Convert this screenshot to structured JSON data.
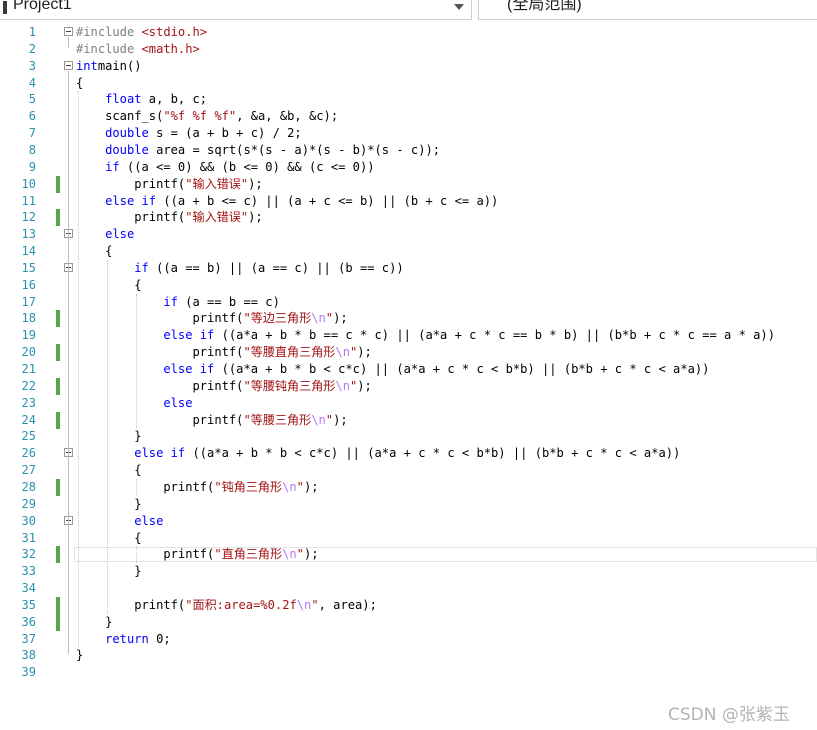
{
  "toolbar": {
    "project_combo": "Project1",
    "scope_combo": "(全局范围)"
  },
  "watermark": "CSDN @张紫玉",
  "code_lines": [
    [
      [
        "pp",
        "#include "
      ],
      [
        "str",
        "<stdio.h>"
      ]
    ],
    [
      [
        "pp",
        "#include "
      ],
      [
        "str",
        "<math.h>"
      ]
    ],
    [
      [
        "kw",
        "int"
      ],
      [
        "",
        "main()"
      ]
    ],
    [
      [
        "",
        "{"
      ]
    ],
    [
      [
        "",
        "    "
      ],
      [
        "kw",
        "float"
      ],
      [
        "",
        " a, b, c;"
      ]
    ],
    [
      [
        "",
        "    scanf_s("
      ],
      [
        "str",
        "\"%f %f %f\""
      ],
      [
        "",
        ", &a, &b, &c);"
      ]
    ],
    [
      [
        "",
        "    "
      ],
      [
        "kw",
        "double"
      ],
      [
        "",
        " s = (a + b + c) / 2;"
      ]
    ],
    [
      [
        "",
        "    "
      ],
      [
        "kw",
        "double"
      ],
      [
        "",
        " area = sqrt(s*(s - a)*(s - b)*(s - c));"
      ]
    ],
    [
      [
        "",
        "    "
      ],
      [
        "kw",
        "if"
      ],
      [
        "",
        " ((a <= 0) && (b <= 0) && (c <= 0))"
      ]
    ],
    [
      [
        "",
        "        printf("
      ],
      [
        "str",
        "\"输入错误\""
      ],
      [
        "",
        ");"
      ]
    ],
    [
      [
        "",
        "    "
      ],
      [
        "kw",
        "else if"
      ],
      [
        "",
        " ((a + b <= c) || (a + c <= b) || (b + c <= a))"
      ]
    ],
    [
      [
        "",
        "        printf("
      ],
      [
        "str",
        "\"输入错误\""
      ],
      [
        "",
        ");"
      ]
    ],
    [
      [
        "",
        "    "
      ],
      [
        "kw",
        "else"
      ]
    ],
    [
      [
        "",
        "    {"
      ]
    ],
    [
      [
        "",
        "        "
      ],
      [
        "kw",
        "if"
      ],
      [
        "",
        " ((a == b) || (a == c) || (b == c))"
      ]
    ],
    [
      [
        "",
        "        {"
      ]
    ],
    [
      [
        "",
        "            "
      ],
      [
        "kw",
        "if"
      ],
      [
        "",
        " (a == b == c)"
      ]
    ],
    [
      [
        "",
        "                printf("
      ],
      [
        "str",
        "\"等边三角形"
      ],
      [
        "esc",
        "\\n"
      ],
      [
        "str",
        "\""
      ],
      [
        "",
        ");"
      ]
    ],
    [
      [
        "",
        "            "
      ],
      [
        "kw",
        "else if"
      ],
      [
        "",
        " ((a*a + b * b == c * c) || (a*a + c * c == b * b) || (b*b + c * c == a * a))"
      ]
    ],
    [
      [
        "",
        "                printf("
      ],
      [
        "str",
        "\"等腰直角三角形"
      ],
      [
        "esc",
        "\\n"
      ],
      [
        "str",
        "\""
      ],
      [
        "",
        ");"
      ]
    ],
    [
      [
        "",
        "            "
      ],
      [
        "kw",
        "else if"
      ],
      [
        "",
        " ((a*a + b * b < c*c) || (a*a + c * c < b*b) || (b*b + c * c < a*a))"
      ]
    ],
    [
      [
        "",
        "                printf("
      ],
      [
        "str",
        "\"等腰钝角三角形"
      ],
      [
        "esc",
        "\\n"
      ],
      [
        "str",
        "\""
      ],
      [
        "",
        ");"
      ]
    ],
    [
      [
        "",
        "            "
      ],
      [
        "kw",
        "else"
      ]
    ],
    [
      [
        "",
        "                printf("
      ],
      [
        "str",
        "\"等腰三角形"
      ],
      [
        "esc",
        "\\n"
      ],
      [
        "str",
        "\""
      ],
      [
        "",
        ");"
      ]
    ],
    [
      [
        "",
        "        }"
      ]
    ],
    [
      [
        "",
        "        "
      ],
      [
        "kw",
        "else if"
      ],
      [
        "",
        " ((a*a + b * b < c*c) || (a*a + c * c < b*b) || (b*b + c * c < a*a))"
      ]
    ],
    [
      [
        "",
        "        {"
      ]
    ],
    [
      [
        "",
        "            printf("
      ],
      [
        "str",
        "\"钝角三角形"
      ],
      [
        "esc",
        "\\n"
      ],
      [
        "str",
        "\""
      ],
      [
        "",
        ");"
      ]
    ],
    [
      [
        "",
        "        }"
      ]
    ],
    [
      [
        "",
        "        "
      ],
      [
        "kw",
        "else"
      ]
    ],
    [
      [
        "",
        "        {"
      ]
    ],
    [
      [
        "",
        "            printf("
      ],
      [
        "str",
        "\"直角三角形"
      ],
      [
        "esc",
        "\\n"
      ],
      [
        "str",
        "\""
      ],
      [
        "",
        ");"
      ]
    ],
    [
      [
        "",
        "        }"
      ]
    ],
    [
      [
        "",
        ""
      ]
    ],
    [
      [
        "",
        "        printf("
      ],
      [
        "str",
        "\"面积:area=%0.2f"
      ],
      [
        "esc",
        "\\n"
      ],
      [
        "str",
        "\""
      ],
      [
        "",
        ", area);"
      ]
    ],
    [
      [
        "",
        "    }"
      ]
    ],
    [
      [
        "",
        "    "
      ],
      [
        "kw",
        "return"
      ],
      [
        "",
        " 0;"
      ]
    ],
    [
      [
        "",
        "}"
      ]
    ],
    [
      [
        "",
        ""
      ]
    ]
  ],
  "changed_lines": [
    10,
    12,
    18,
    20,
    22,
    24,
    28,
    32,
    35,
    36
  ],
  "fold_lines": [
    1,
    3,
    13,
    15,
    26,
    30
  ],
  "current_line": 32
}
